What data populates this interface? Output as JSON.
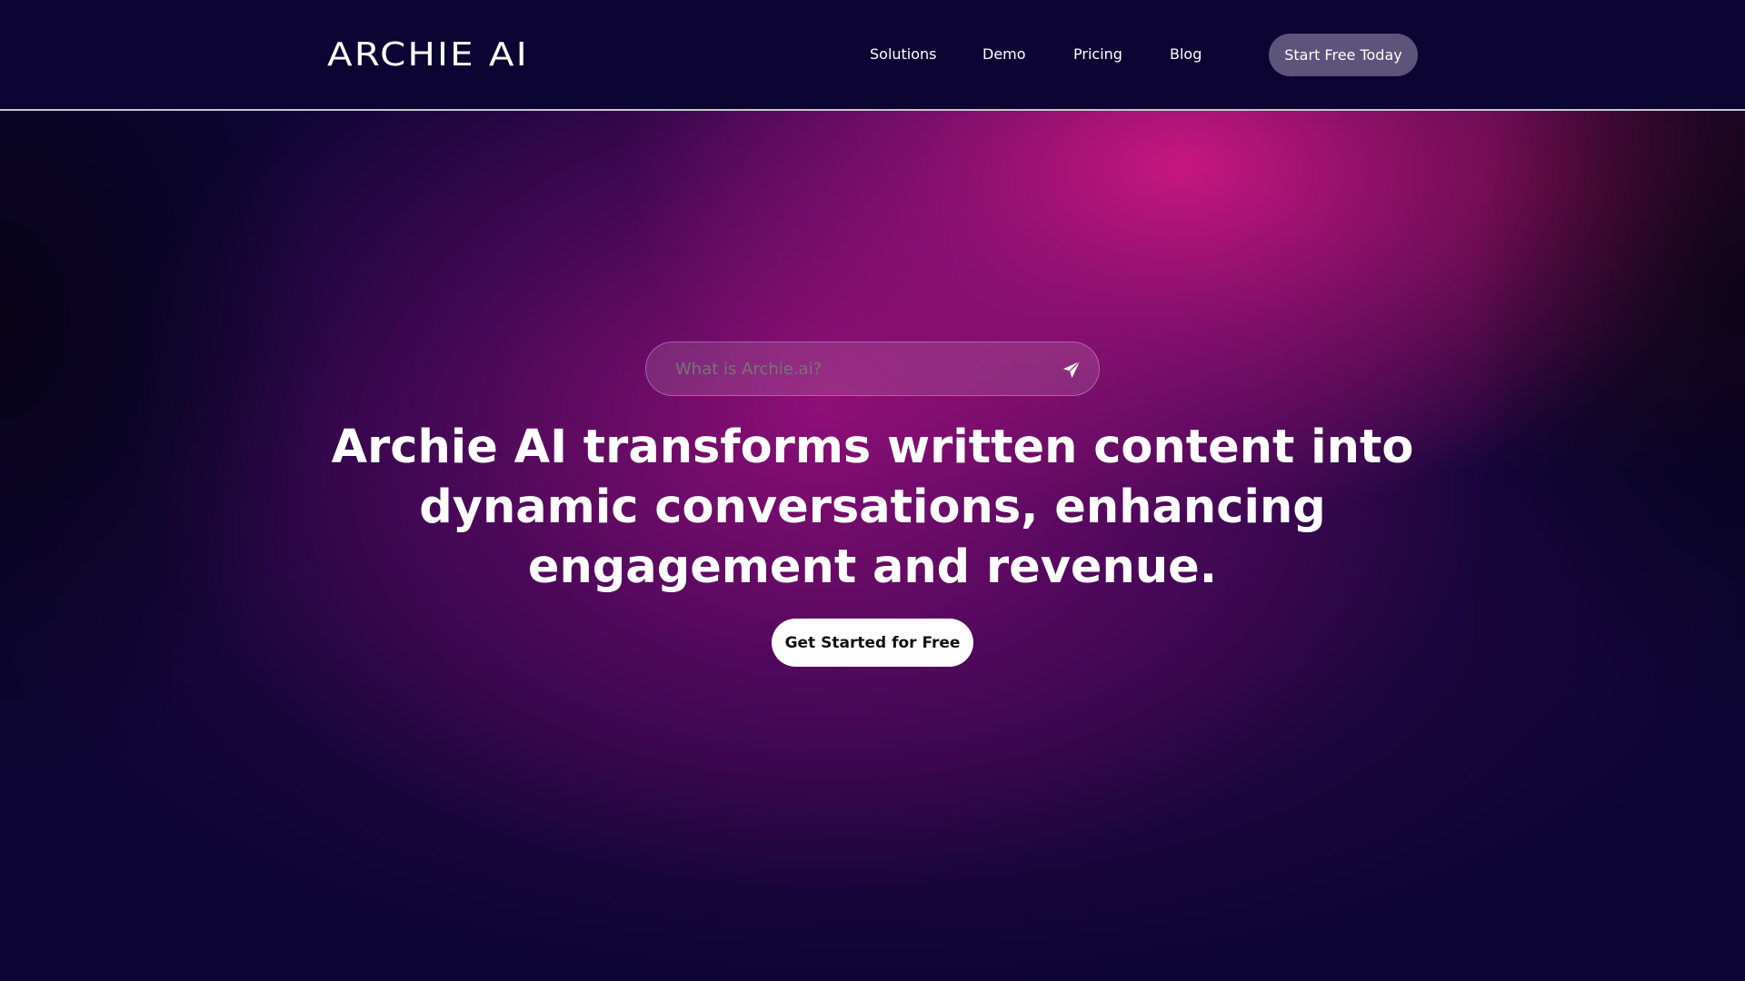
{
  "brand": {
    "logo_text": "ARCHIE AI"
  },
  "nav": {
    "items": [
      {
        "label": "Solutions"
      },
      {
        "label": "Demo"
      },
      {
        "label": "Pricing"
      },
      {
        "label": "Blog"
      }
    ],
    "cta_label": "Start Free Today"
  },
  "hero": {
    "search": {
      "placeholder": "What is Archie.ai?",
      "value": "",
      "icon": "send-icon"
    },
    "headline": "Archie AI transforms written content into dynamic conversations, enhancing engagement and revenue.",
    "cta_label": "Get Started for Free"
  },
  "colors": {
    "background": "#0c0534",
    "accent_magenta": "#d61886",
    "nav_button": "#5d547c",
    "primary_button": "#ffffff"
  }
}
